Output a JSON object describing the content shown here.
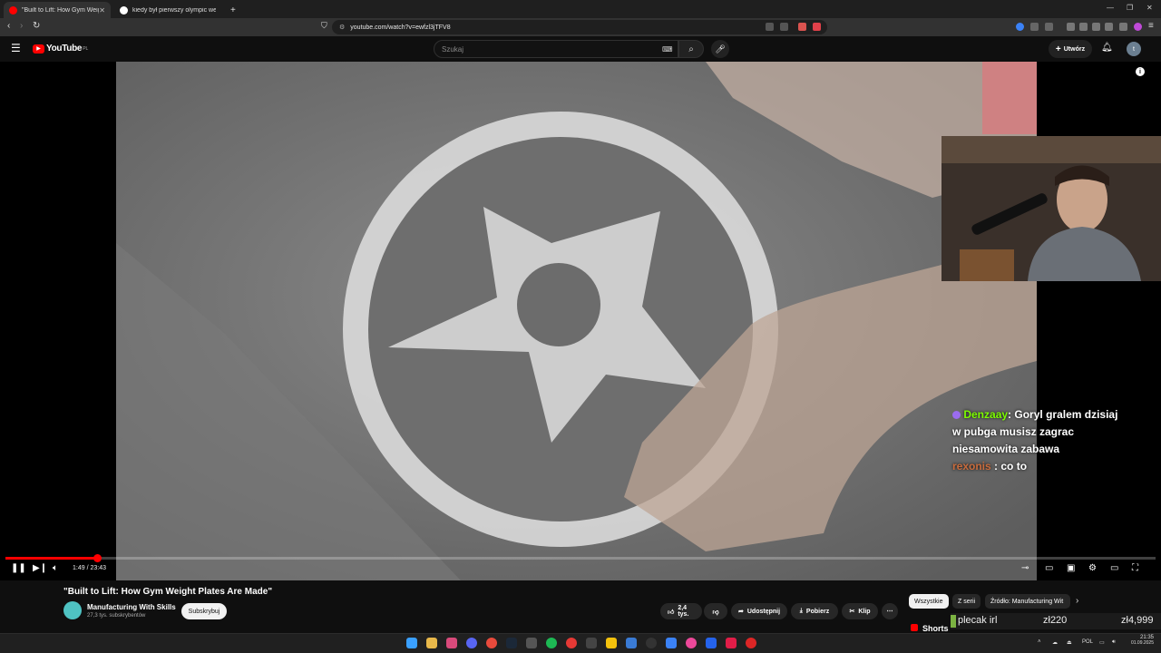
{
  "browser": {
    "tabs": [
      {
        "title": "\"Built to Lift: How Gym Weig",
        "active": true
      },
      {
        "title": "kiedy był pierwszy olympic weightlift",
        "active": false
      }
    ],
    "new_tab_label": "+",
    "url": "youtube.com/watch?v=ewfzl3jTFV8"
  },
  "youtube": {
    "logo_text": "YouTube",
    "region": "PL",
    "search_placeholder": "Szukaj",
    "create_label": "Utwórz",
    "avatar_letter": "t"
  },
  "player": {
    "progress": 0.0796,
    "current_time": "1:49",
    "duration": "23:43",
    "time_separator": " / "
  },
  "stream_overlay": {
    "chat": [
      {
        "user": "Denzaay",
        "user_color": "#7cfc00",
        "message": "Goryl gralem dzisiaj w pubga musisz zagrac niesamowita zabawa"
      },
      {
        "user": "rexonis",
        "user_color": "#c86b3c",
        "message": "co to"
      }
    ]
  },
  "video_info": {
    "title": "\"Built to Lift: How Gym Weight Plates Are Made\"",
    "channel": "Manufacturing With Skills",
    "subscribers": "27,3 tys. subskrybentów",
    "subscribe_label": "Subskrybuj",
    "likes": "2,4 tys.",
    "share_label": "Udostępnij",
    "download_label": "Pobierz",
    "clip_label": "Klip",
    "more_label": "⋯"
  },
  "recommendations": {
    "chips": [
      "Wszystkie",
      "Z serii",
      "Źródło: Manufacturing Wit"
    ],
    "shorts_label": "Shorts"
  },
  "ticker": {
    "item": "plecak irl",
    "price1": "zł220",
    "price2": "zł4,999"
  },
  "taskbar": {
    "language": "POL",
    "time": "21:35",
    "date": "01.09.2025"
  },
  "colors": {
    "youtube_red": "#ff0000",
    "background": "#0f0f0f"
  }
}
